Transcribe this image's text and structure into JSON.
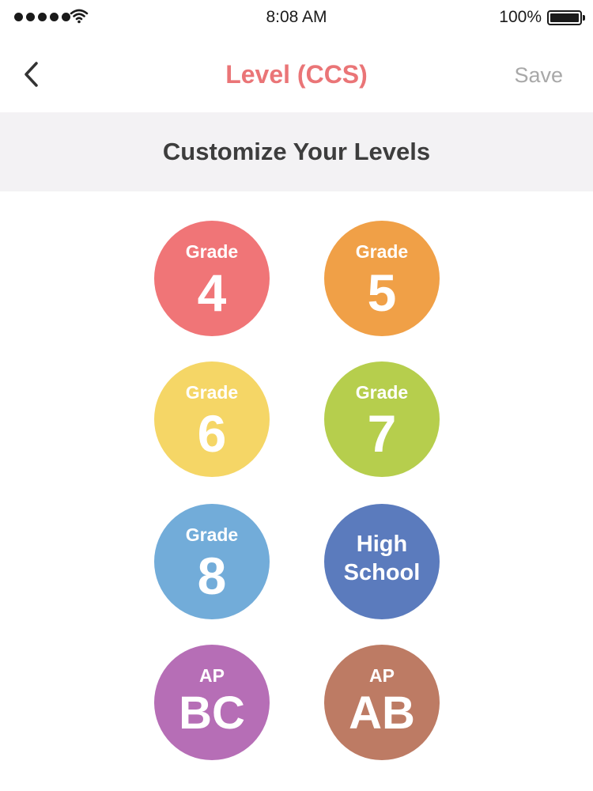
{
  "status_bar": {
    "time": "8:08 AM",
    "battery": "100%"
  },
  "nav": {
    "title": "Level (CCS)",
    "save_label": "Save"
  },
  "section": {
    "title": "Customize Your Levels"
  },
  "levels": [
    {
      "label": "Grade",
      "value": "4",
      "color": "#f07577"
    },
    {
      "label": "Grade",
      "value": "5",
      "color": "#f0a047"
    },
    {
      "label": "Grade",
      "value": "6",
      "color": "#f5d666"
    },
    {
      "label": "Grade",
      "value": "7",
      "color": "#b6ce4d"
    },
    {
      "label": "Grade",
      "value": "8",
      "color": "#72acd9"
    },
    {
      "line1": "High",
      "line2": "School",
      "color": "#5b7bbd"
    },
    {
      "label": "AP",
      "value": "BC",
      "color": "#b66eb6"
    },
    {
      "label": "AP",
      "value": "AB",
      "color": "#bd7b64"
    }
  ]
}
